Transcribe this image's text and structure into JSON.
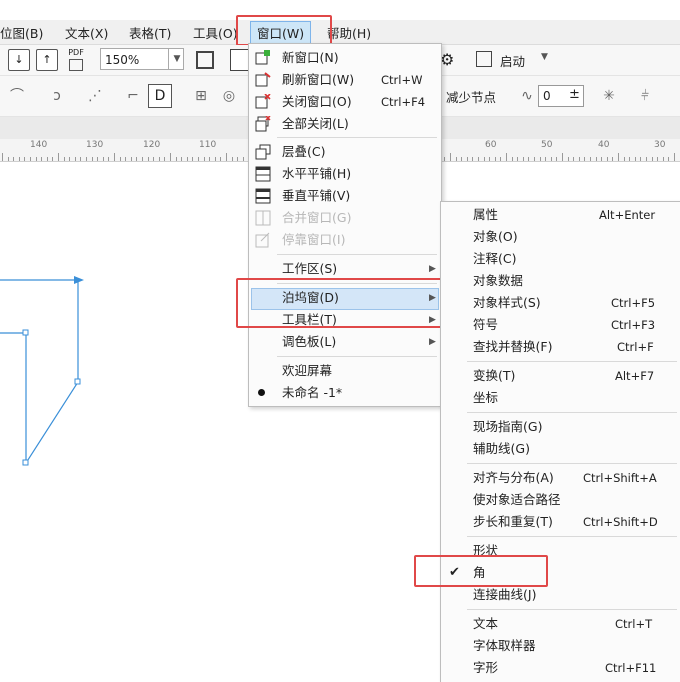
{
  "menubar": {
    "items": [
      {
        "label": "位图(B)"
      },
      {
        "label": "文本(X)"
      },
      {
        "label": "表格(T)"
      },
      {
        "label": "工具(O)"
      },
      {
        "label": "窗口(W)"
      },
      {
        "label": "帮助(H)"
      }
    ]
  },
  "toolbar": {
    "zoom_value": "150%",
    "pdf_label": "PDF",
    "launch_label": "启动",
    "reduce_nodes_label": "减少节点",
    "spinner_value": "0"
  },
  "ruler": {
    "ticks": [
      "140",
      "130",
      "120",
      "110",
      "60",
      "50",
      "40",
      "30"
    ]
  },
  "window_menu": {
    "items": [
      {
        "label": "新窗口(N)",
        "shortcut": ""
      },
      {
        "label": "刷新窗口(W)",
        "shortcut": "Ctrl+W"
      },
      {
        "label": "关闭窗口(O)",
        "shortcut": "Ctrl+F4"
      },
      {
        "label": "全部关闭(L)",
        "shortcut": ""
      },
      {
        "label": "层叠(C)",
        "shortcut": ""
      },
      {
        "label": "水平平铺(H)",
        "shortcut": ""
      },
      {
        "label": "垂直平铺(V)",
        "shortcut": ""
      },
      {
        "label": "合并窗口(G)",
        "shortcut": ""
      },
      {
        "label": "停靠窗口(I)",
        "shortcut": ""
      },
      {
        "label": "工作区(S)",
        "shortcut": ""
      },
      {
        "label": "泊坞窗(D)",
        "shortcut": ""
      },
      {
        "label": "工具栏(T)",
        "shortcut": ""
      },
      {
        "label": "调色板(L)",
        "shortcut": ""
      },
      {
        "label": "欢迎屏幕",
        "shortcut": ""
      },
      {
        "label": "未命名 -1*",
        "shortcut": ""
      }
    ]
  },
  "docker_menu": {
    "items": [
      {
        "label": "属性",
        "shortcut": "Alt+Enter"
      },
      {
        "label": "对象(O)",
        "shortcut": ""
      },
      {
        "label": "注释(C)",
        "shortcut": ""
      },
      {
        "label": "对象数据",
        "shortcut": ""
      },
      {
        "label": "对象样式(S)",
        "shortcut": "Ctrl+F5"
      },
      {
        "label": "符号",
        "shortcut": "Ctrl+F3"
      },
      {
        "label": "查找并替换(F)",
        "shortcut": "Ctrl+F"
      },
      {
        "label": "变换(T)",
        "shortcut": "Alt+F7"
      },
      {
        "label": "坐标",
        "shortcut": ""
      },
      {
        "label": "现场指南(G)",
        "shortcut": ""
      },
      {
        "label": "辅助线(G)",
        "shortcut": ""
      },
      {
        "label": "对齐与分布(A)",
        "shortcut": "Ctrl+Shift+A"
      },
      {
        "label": "使对象适合路径",
        "shortcut": ""
      },
      {
        "label": "步长和重复(T)",
        "shortcut": "Ctrl+Shift+D"
      },
      {
        "label": "形状",
        "shortcut": ""
      },
      {
        "label": "角",
        "shortcut": ""
      },
      {
        "label": "连接曲线(J)",
        "shortcut": ""
      },
      {
        "label": "文本",
        "shortcut": "Ctrl+T"
      },
      {
        "label": "字体取样器",
        "shortcut": ""
      },
      {
        "label": "字形",
        "shortcut": "Ctrl+F11"
      }
    ]
  },
  "colors": {
    "highlight_border": "#e04848",
    "selection_line": "#3a8fd8"
  }
}
